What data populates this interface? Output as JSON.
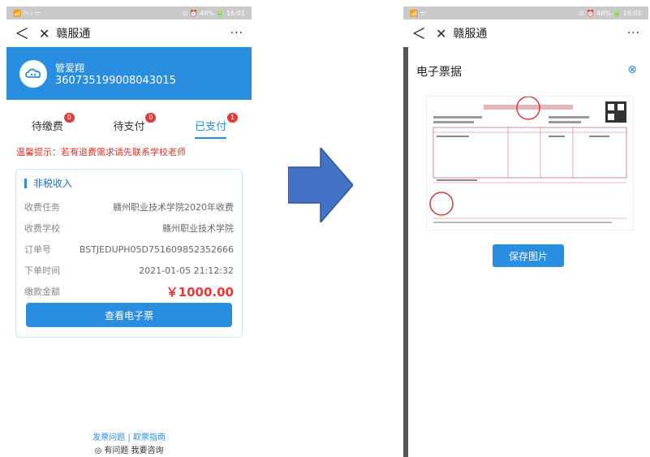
{
  "left": {
    "status": {
      "left": "📶 ⁵ᵍ ᵢₗ ᯤ",
      "right": "⊙ ⏰ 48% 🔋 16:01"
    },
    "nav": {
      "back": "＜",
      "close": "✕",
      "title": "赣服通",
      "more": "···"
    },
    "user": {
      "name": "管爱翔",
      "id": "360735199008043015"
    },
    "tabs": [
      {
        "label": "待缴费",
        "badge": "0"
      },
      {
        "label": "待支付",
        "badge": "0"
      },
      {
        "label": "已支付",
        "badge": "1"
      }
    ],
    "notice": "温馨提示：若有退费需求请先联系学校老师",
    "card": {
      "title": "非税收入",
      "rows": [
        {
          "label": "收费任务",
          "value": "赣州职业技术学院2020年收费"
        },
        {
          "label": "收费学校",
          "value": "赣州职业技术学院"
        },
        {
          "label": "订单号",
          "value": "BSTJEDUPH05D751609852352666"
        },
        {
          "label": "下单时间",
          "value": "2021-01-05 21:12:32"
        },
        {
          "label": "缴款金额",
          "value": "￥1000.00"
        }
      ],
      "button": "查看电子票"
    },
    "footer": {
      "link1": "发票问题",
      "sep": "|",
      "link2": "取票指南",
      "consult": "有问题 我要咨询"
    }
  },
  "right": {
    "status": {
      "left": "📶 ᯤ",
      "right": "⊙ ⏰ 48% 🔋 16:01"
    },
    "nav": {
      "back": "＜",
      "close": "✕",
      "title": "赣服通",
      "more": "···"
    },
    "receipt_title": "电子票据",
    "close_icon": "⊗",
    "save_button": "保存图片"
  },
  "colors": {
    "primary": "#2a8ee0",
    "danger": "#e23b3b"
  }
}
